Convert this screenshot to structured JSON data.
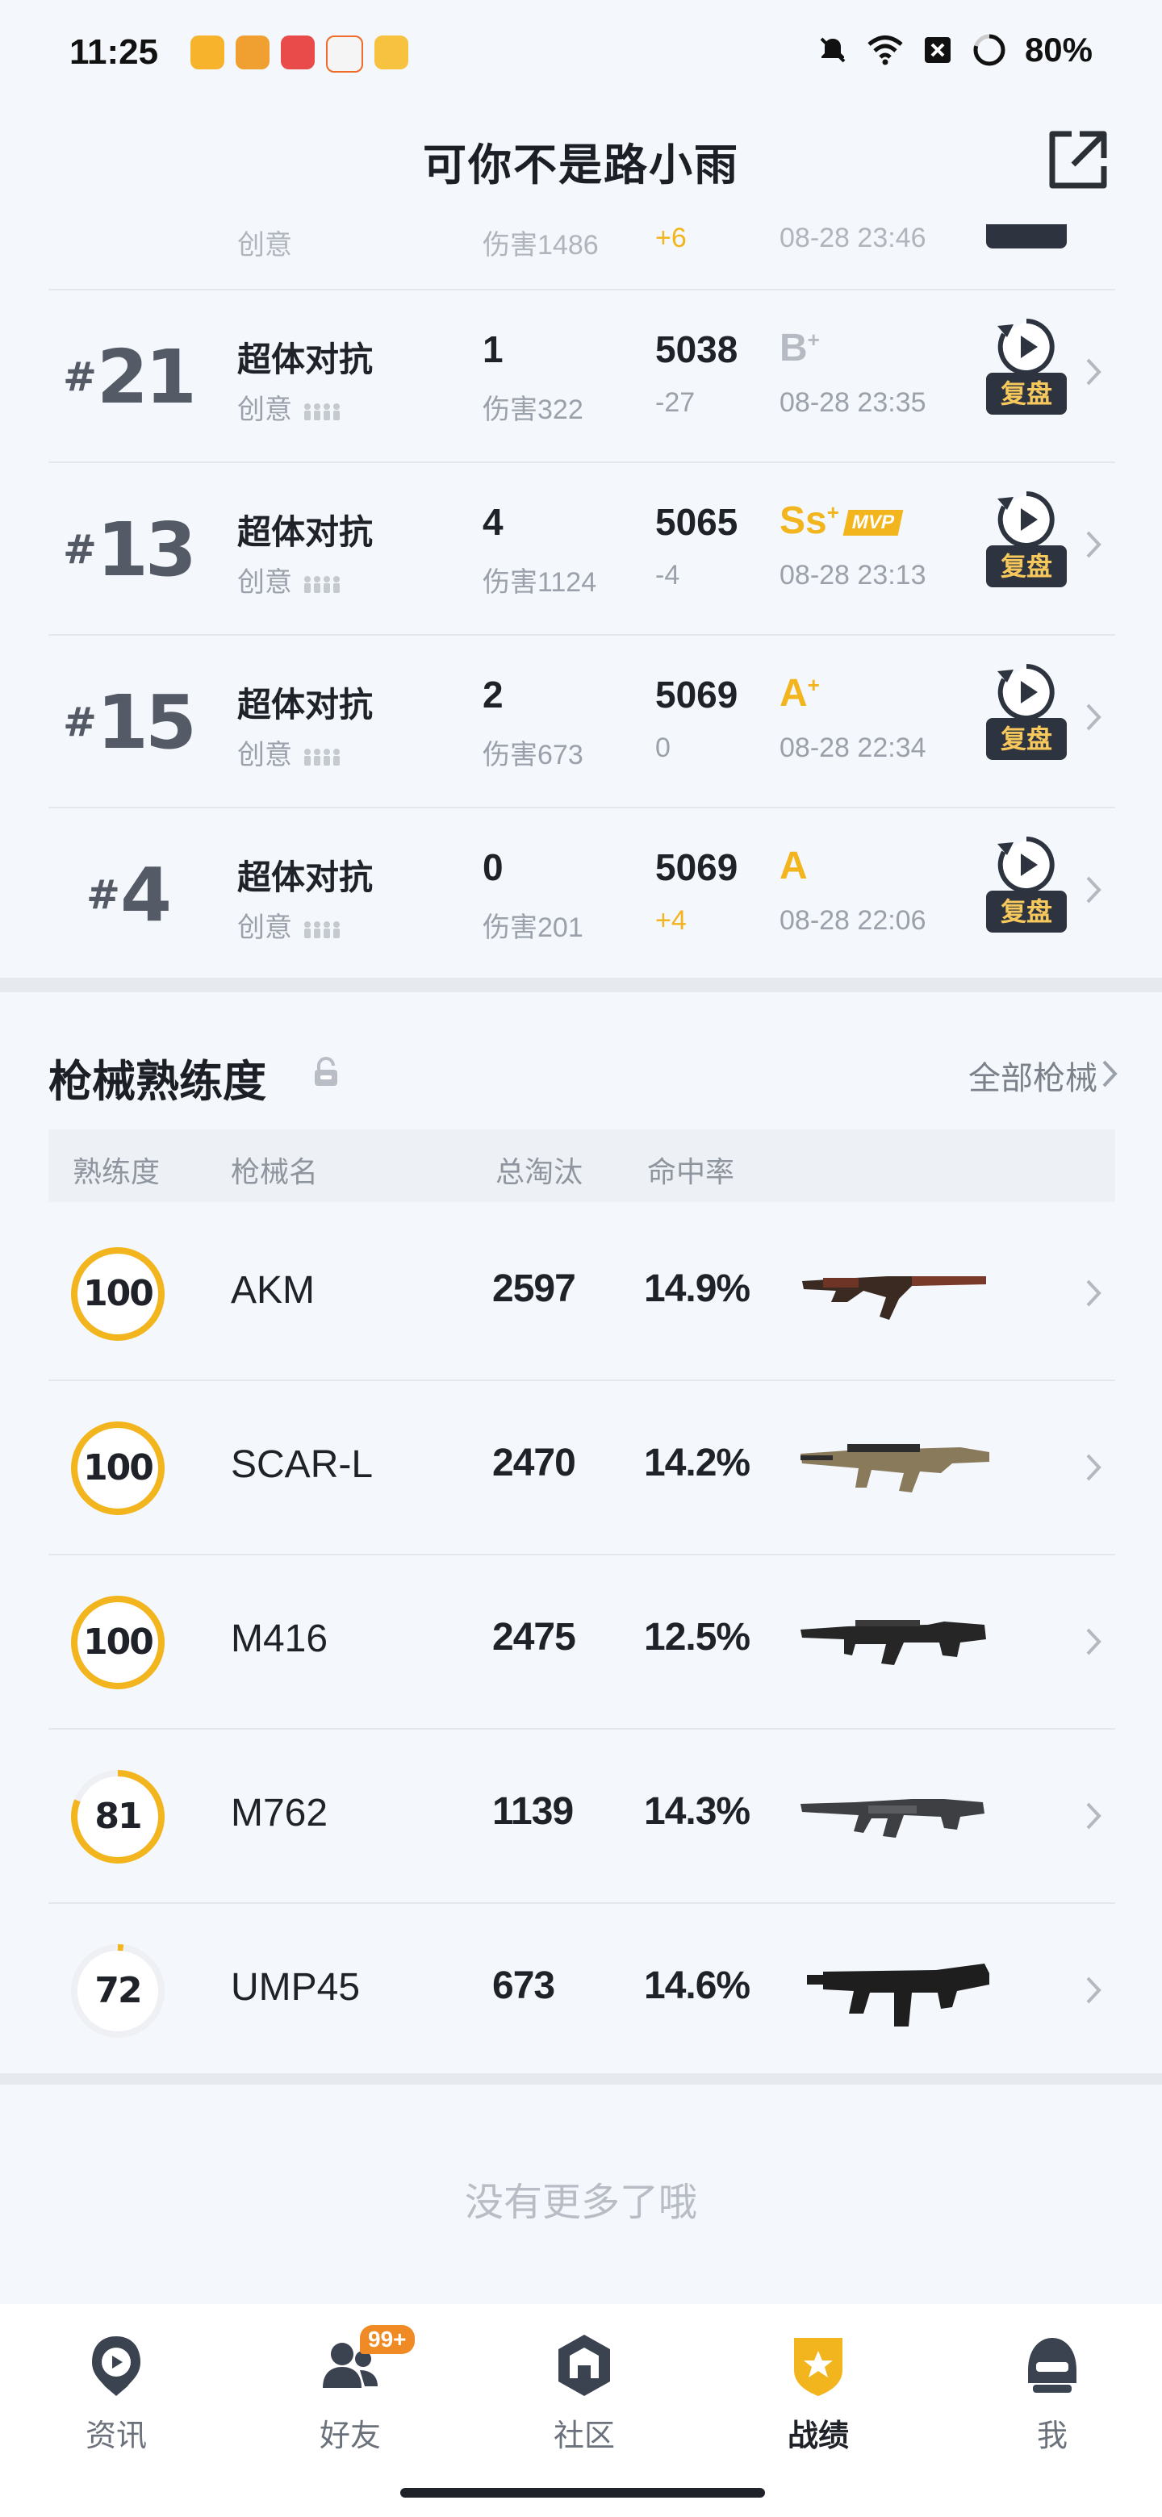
{
  "status_bar": {
    "time": "11:25",
    "battery": "80%"
  },
  "header": {
    "title": "可你不是路小雨"
  },
  "matches": [
    {
      "rank_hash": "#",
      "rank": "21",
      "mode": "超体对抗",
      "sub": "创意",
      "kills": "1",
      "damage": "伤害322",
      "rating": "5038",
      "delta": "-27",
      "delta_positive": false,
      "grade": "B",
      "grade_plus": "+",
      "grade_color": "grey",
      "mvp": "",
      "date": "08-28 23:35",
      "replay_label": "复盘"
    },
    {
      "rank_hash": "#",
      "rank": "13",
      "mode": "超体对抗",
      "sub": "创意",
      "kills": "4",
      "damage": "伤害1124",
      "rating": "5065",
      "delta": "-4",
      "delta_positive": false,
      "grade": "Ss",
      "grade_plus": "+",
      "grade_color": "gold",
      "mvp": "MVP",
      "date": "08-28 23:13",
      "replay_label": "复盘"
    },
    {
      "rank_hash": "#",
      "rank": "15",
      "mode": "超体对抗",
      "sub": "创意",
      "kills": "2",
      "damage": "伤害673",
      "rating": "5069",
      "delta": "0",
      "delta_positive": false,
      "grade": "A",
      "grade_plus": "+",
      "grade_color": "gold",
      "mvp": "",
      "date": "08-28 22:34",
      "replay_label": "复盘"
    },
    {
      "rank_hash": "#",
      "rank": "4",
      "mode": "超体对抗",
      "sub": "创意",
      "kills": "0",
      "damage": "伤害201",
      "rating": "5069",
      "delta": "+4",
      "delta_positive": true,
      "grade": "A",
      "grade_plus": "",
      "grade_color": "gold",
      "mvp": "",
      "date": "08-28 22:06",
      "replay_label": "复盘"
    }
  ],
  "partial_match": {
    "sub": "创意",
    "damage": "伤害1486",
    "delta": "+6",
    "date": "08-28 23:46"
  },
  "weapons_section": {
    "title": "枪械熟练度",
    "all_link": "全部枪械",
    "headers": {
      "proficiency": "熟练度",
      "name": "枪械名",
      "kills": "总淘汰",
      "accuracy": "命中率"
    },
    "items": [
      {
        "proficiency": "100",
        "proficiency_fraction": 1.0,
        "name": "AKM",
        "kills": "2597",
        "accuracy": "14.9%",
        "gun_icon": "akm-rifle-icon"
      },
      {
        "proficiency": "100",
        "proficiency_fraction": 1.0,
        "name": "SCAR-L",
        "kills": "2470",
        "accuracy": "14.2%",
        "gun_icon": "scar-l-rifle-icon"
      },
      {
        "proficiency": "100",
        "proficiency_fraction": 1.0,
        "name": "M416",
        "kills": "2475",
        "accuracy": "12.5%",
        "gun_icon": "m416-rifle-icon"
      },
      {
        "proficiency": "81",
        "proficiency_fraction": 0.81,
        "name": "M762",
        "kills": "1139",
        "accuracy": "14.3%",
        "gun_icon": "m762-rifle-icon"
      },
      {
        "proficiency": "72",
        "proficiency_fraction": 0.02,
        "name": "UMP45",
        "kills": "673",
        "accuracy": "14.6%",
        "gun_icon": "ump45-smg-icon"
      }
    ]
  },
  "footer": {
    "no_more": "没有更多了哦"
  },
  "tabs": [
    {
      "label": "资讯",
      "icon": "news-icon",
      "active": false
    },
    {
      "label": "好友",
      "icon": "friends-icon",
      "active": false,
      "badge": "99+"
    },
    {
      "label": "社区",
      "icon": "community-icon",
      "active": false
    },
    {
      "label": "战绩",
      "icon": "stats-icon",
      "active": true
    },
    {
      "label": "我",
      "icon": "profile-icon",
      "active": false
    }
  ],
  "colors": {
    "accent": "#f2b51d",
    "text": "#1f2329",
    "muted": "#9ba1ab",
    "background": "#f4f7fb",
    "badge": "#f08a24"
  }
}
